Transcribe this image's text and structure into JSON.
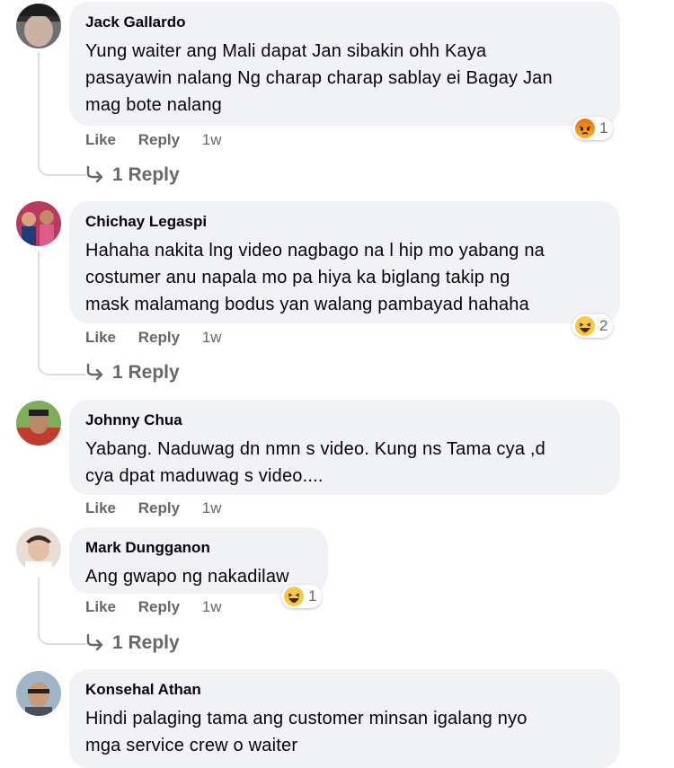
{
  "comments": [
    {
      "author": "Jack Gallardo",
      "lines": [
        "Yung waiter ang Mali dapat Jan sibakin ohh Kaya",
        "pasayawin nalang Ng charap charap sablay ei Bagay Jan",
        "mag bote nalang"
      ],
      "like": "Like",
      "reply": "Reply",
      "time": "1w",
      "reaction": {
        "type": "angry",
        "count": "1"
      },
      "replies": "1 Reply"
    },
    {
      "author": "Chichay Legaspi",
      "lines": [
        "Hahaha nakita lng video nagbago na l hip mo yabang na",
        "costumer anu napala mo pa hiya ka biglang takip ng",
        "mask malamang bodus yan walang pambayad hahaha"
      ],
      "like": "Like",
      "reply": "Reply",
      "time": "1w",
      "reaction": {
        "type": "haha",
        "count": "2"
      },
      "replies": "1 Reply"
    },
    {
      "author": "Johnny Chua",
      "lines": [
        "Yabang. Naduwag dn nmn s video. Kung ns Tama cya ,d",
        "cya dpat maduwag s video...."
      ],
      "like": "Like",
      "reply": "Reply",
      "time": "1w"
    },
    {
      "author": "Mark Dungganon",
      "lines": [
        "Ang gwapo ng nakadilaw"
      ],
      "like": "Like",
      "reply": "Reply",
      "time": "1w",
      "reaction": {
        "type": "haha",
        "count": "1"
      },
      "replies": "1 Reply"
    },
    {
      "author": "Konsehal Athan",
      "lines": [
        "Hindi palaging tama ang customer minsan igalang nyo",
        "mga service crew o waiter"
      ]
    }
  ],
  "colors": {
    "bubble": "#f0f2f5",
    "meta": "#65676b",
    "text": "#050505",
    "thread": "#dadde1"
  }
}
